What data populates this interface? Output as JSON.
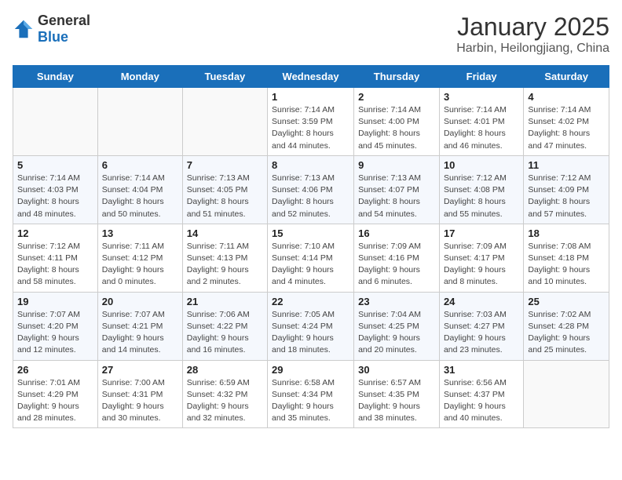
{
  "header": {
    "logo_general": "General",
    "logo_blue": "Blue",
    "month": "January 2025",
    "location": "Harbin, Heilongjiang, China"
  },
  "weekdays": [
    "Sunday",
    "Monday",
    "Tuesday",
    "Wednesday",
    "Thursday",
    "Friday",
    "Saturday"
  ],
  "weeks": [
    [
      {
        "day": "",
        "info": ""
      },
      {
        "day": "",
        "info": ""
      },
      {
        "day": "",
        "info": ""
      },
      {
        "day": "1",
        "info": "Sunrise: 7:14 AM\nSunset: 3:59 PM\nDaylight: 8 hours\nand 44 minutes."
      },
      {
        "day": "2",
        "info": "Sunrise: 7:14 AM\nSunset: 4:00 PM\nDaylight: 8 hours\nand 45 minutes."
      },
      {
        "day": "3",
        "info": "Sunrise: 7:14 AM\nSunset: 4:01 PM\nDaylight: 8 hours\nand 46 minutes."
      },
      {
        "day": "4",
        "info": "Sunrise: 7:14 AM\nSunset: 4:02 PM\nDaylight: 8 hours\nand 47 minutes."
      }
    ],
    [
      {
        "day": "5",
        "info": "Sunrise: 7:14 AM\nSunset: 4:03 PM\nDaylight: 8 hours\nand 48 minutes."
      },
      {
        "day": "6",
        "info": "Sunrise: 7:14 AM\nSunset: 4:04 PM\nDaylight: 8 hours\nand 50 minutes."
      },
      {
        "day": "7",
        "info": "Sunrise: 7:13 AM\nSunset: 4:05 PM\nDaylight: 8 hours\nand 51 minutes."
      },
      {
        "day": "8",
        "info": "Sunrise: 7:13 AM\nSunset: 4:06 PM\nDaylight: 8 hours\nand 52 minutes."
      },
      {
        "day": "9",
        "info": "Sunrise: 7:13 AM\nSunset: 4:07 PM\nDaylight: 8 hours\nand 54 minutes."
      },
      {
        "day": "10",
        "info": "Sunrise: 7:12 AM\nSunset: 4:08 PM\nDaylight: 8 hours\nand 55 minutes."
      },
      {
        "day": "11",
        "info": "Sunrise: 7:12 AM\nSunset: 4:09 PM\nDaylight: 8 hours\nand 57 minutes."
      }
    ],
    [
      {
        "day": "12",
        "info": "Sunrise: 7:12 AM\nSunset: 4:11 PM\nDaylight: 8 hours\nand 58 minutes."
      },
      {
        "day": "13",
        "info": "Sunrise: 7:11 AM\nSunset: 4:12 PM\nDaylight: 9 hours\nand 0 minutes."
      },
      {
        "day": "14",
        "info": "Sunrise: 7:11 AM\nSunset: 4:13 PM\nDaylight: 9 hours\nand 2 minutes."
      },
      {
        "day": "15",
        "info": "Sunrise: 7:10 AM\nSunset: 4:14 PM\nDaylight: 9 hours\nand 4 minutes."
      },
      {
        "day": "16",
        "info": "Sunrise: 7:09 AM\nSunset: 4:16 PM\nDaylight: 9 hours\nand 6 minutes."
      },
      {
        "day": "17",
        "info": "Sunrise: 7:09 AM\nSunset: 4:17 PM\nDaylight: 9 hours\nand 8 minutes."
      },
      {
        "day": "18",
        "info": "Sunrise: 7:08 AM\nSunset: 4:18 PM\nDaylight: 9 hours\nand 10 minutes."
      }
    ],
    [
      {
        "day": "19",
        "info": "Sunrise: 7:07 AM\nSunset: 4:20 PM\nDaylight: 9 hours\nand 12 minutes."
      },
      {
        "day": "20",
        "info": "Sunrise: 7:07 AM\nSunset: 4:21 PM\nDaylight: 9 hours\nand 14 minutes."
      },
      {
        "day": "21",
        "info": "Sunrise: 7:06 AM\nSunset: 4:22 PM\nDaylight: 9 hours\nand 16 minutes."
      },
      {
        "day": "22",
        "info": "Sunrise: 7:05 AM\nSunset: 4:24 PM\nDaylight: 9 hours\nand 18 minutes."
      },
      {
        "day": "23",
        "info": "Sunrise: 7:04 AM\nSunset: 4:25 PM\nDaylight: 9 hours\nand 20 minutes."
      },
      {
        "day": "24",
        "info": "Sunrise: 7:03 AM\nSunset: 4:27 PM\nDaylight: 9 hours\nand 23 minutes."
      },
      {
        "day": "25",
        "info": "Sunrise: 7:02 AM\nSunset: 4:28 PM\nDaylight: 9 hours\nand 25 minutes."
      }
    ],
    [
      {
        "day": "26",
        "info": "Sunrise: 7:01 AM\nSunset: 4:29 PM\nDaylight: 9 hours\nand 28 minutes."
      },
      {
        "day": "27",
        "info": "Sunrise: 7:00 AM\nSunset: 4:31 PM\nDaylight: 9 hours\nand 30 minutes."
      },
      {
        "day": "28",
        "info": "Sunrise: 6:59 AM\nSunset: 4:32 PM\nDaylight: 9 hours\nand 32 minutes."
      },
      {
        "day": "29",
        "info": "Sunrise: 6:58 AM\nSunset: 4:34 PM\nDaylight: 9 hours\nand 35 minutes."
      },
      {
        "day": "30",
        "info": "Sunrise: 6:57 AM\nSunset: 4:35 PM\nDaylight: 9 hours\nand 38 minutes."
      },
      {
        "day": "31",
        "info": "Sunrise: 6:56 AM\nSunset: 4:37 PM\nDaylight: 9 hours\nand 40 minutes."
      },
      {
        "day": "",
        "info": ""
      }
    ]
  ]
}
